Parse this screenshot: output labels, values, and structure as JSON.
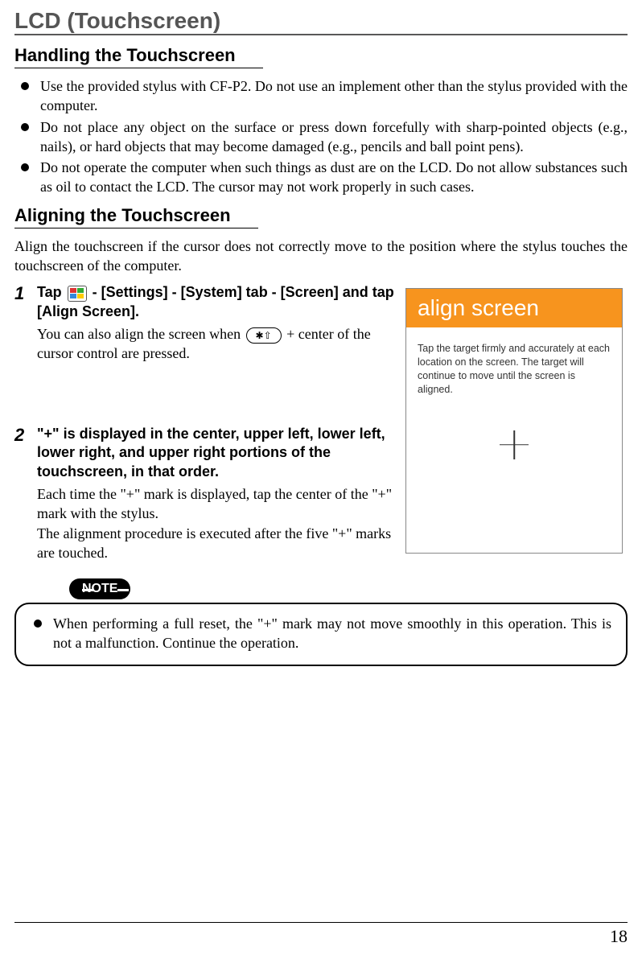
{
  "page": {
    "title": "LCD (Touchscreen)",
    "number": "18"
  },
  "section1": {
    "heading": "Handling the Touchscreen",
    "bullets": [
      "Use the provided stylus with CF-P2. Do not use an implement other than the stylus provided with the computer.",
      "Do not place any object on the surface or press down forcefully with sharp-pointed objects (e.g., nails), or hard objects that may become damaged (e.g., pencils and ball point pens).",
      "Do not operate the computer when such things as dust are on the LCD.  Do not allow substances such as oil to contact the LCD.  The cursor may not work properly in such cases."
    ]
  },
  "section2": {
    "heading": "Aligning the Touchscreen",
    "intro": "Align the touchscreen if the cursor does not correctly move to the position where the stylus touches the touchscreen of the computer.",
    "steps": [
      {
        "num": "1",
        "title_pre": "Tap ",
        "title_post": " - [Settings] - [System] tab - [Screen] and tap [Align Screen].",
        "body": "You can also align the screen when ",
        "body_post": " + center of the cursor control are pressed.",
        "icon1_name": "windows-start-icon",
        "icon2_name": "asterisk-shift-key",
        "icon2_glyph": "✱⇧"
      },
      {
        "num": "2",
        "title": "\"+\" is displayed in the center, upper left, lower left, lower right, and upper right portions of the touchscreen, in that order.",
        "body": "Each time the \"+\" mark is displayed, tap  the center of the \"+\" mark with the stylus.\nThe alignment procedure is executed after the five \"+\" marks are touched."
      }
    ]
  },
  "screen": {
    "title": "align screen",
    "body": "Tap the target firmly and accurately at each location on the screen. The target will continue to move until the screen is aligned."
  },
  "note": {
    "label": "NOTE",
    "bullets": [
      "When performing a full reset, the \"+\" mark may not move smoothly in this operation. This is not a malfunction. Continue the operation."
    ]
  }
}
